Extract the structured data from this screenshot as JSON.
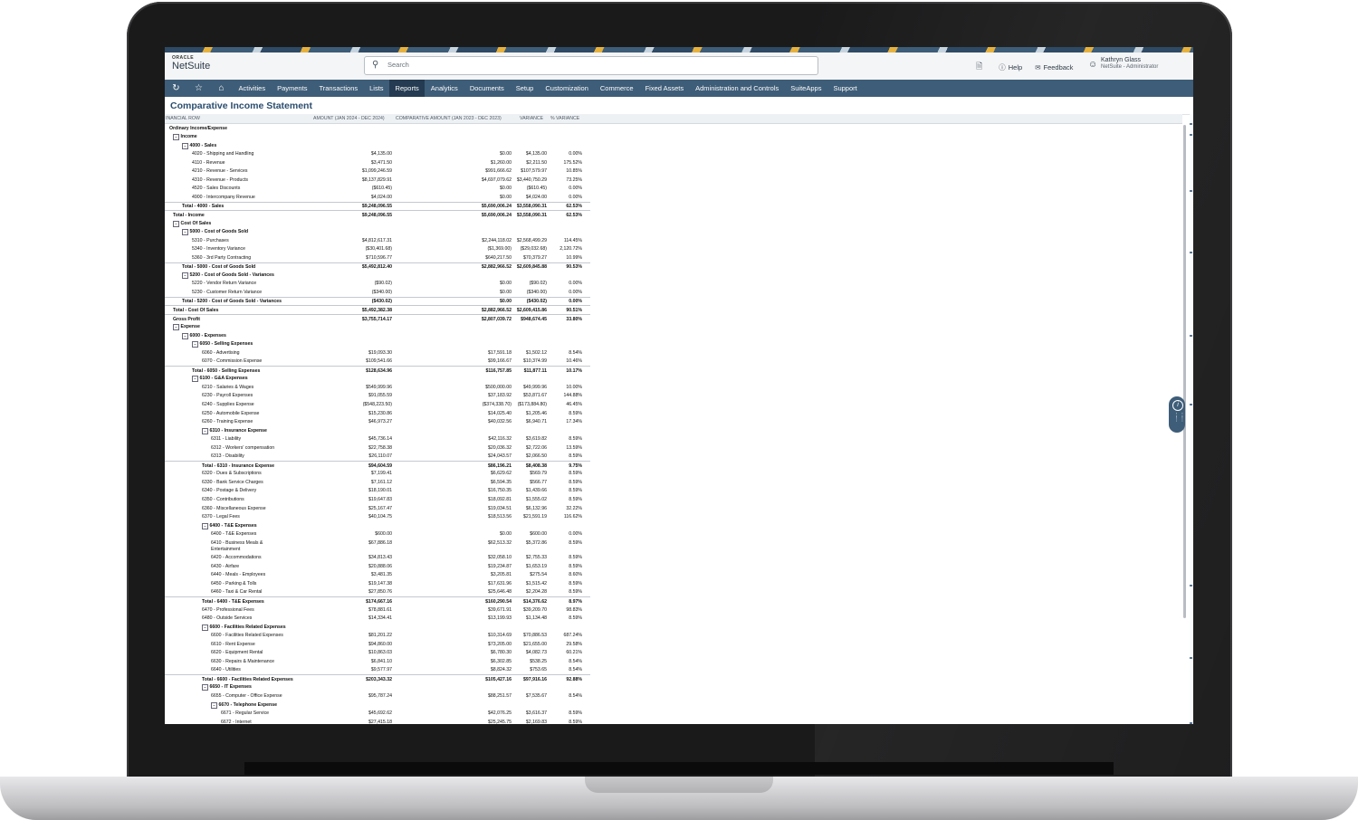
{
  "app": {
    "brand_small": "ORACLE",
    "brand": "NetSuite",
    "search_placeholder": "Search",
    "help": "Help",
    "feedback": "Feedback",
    "user_name": "Kathryn Glass",
    "user_role": "NetSuite - Administrator"
  },
  "nav": [
    "Activities",
    "Payments",
    "Transactions",
    "Lists",
    "Reports",
    "Analytics",
    "Documents",
    "Setup",
    "Customization",
    "Commerce",
    "Fixed Assets",
    "Administration and Controls",
    "SuiteApps",
    "Support"
  ],
  "nav_active": "Reports",
  "page_title": "Comparative Income Statement",
  "columns": {
    "row": "INANCIAL ROW",
    "amount": "AMOUNT (JAN 2024 - DEC 2024)",
    "comparative": "COMPARATIVE AMOUNT (JAN 2023 - DEC 2023)",
    "variance": "VARIANCE",
    "pct": "% VARIANCE"
  },
  "rows": [
    {
      "l": 0,
      "t": "Ordinary Income/Expense",
      "b": true,
      "tg": false
    },
    {
      "l": 1,
      "t": "Income",
      "b": true,
      "tg": true
    },
    {
      "l": 2,
      "t": "4000 - Sales",
      "b": true,
      "tg": true
    },
    {
      "l": 3,
      "t": "4020 - Shipping and Handling",
      "v": [
        "$4,135.00",
        "$0.00",
        "$4,135.00",
        "0.00%"
      ]
    },
    {
      "l": 3,
      "t": "4110 - Revenue",
      "v": [
        "$3,471.50",
        "$1,260.00",
        "$2,211.50",
        "175.52%"
      ]
    },
    {
      "l": 3,
      "t": "4210 - Revenue - Services",
      "v": [
        "$1,099,246.59",
        "$991,666.62",
        "$107,579.97",
        "10.85%"
      ]
    },
    {
      "l": 3,
      "t": "4310 - Revenue - Products",
      "v": [
        "$8,137,829.91",
        "$4,697,079.62",
        "$3,440,750.29",
        "73.25%"
      ]
    },
    {
      "l": 3,
      "t": "4520 - Sales Discounts",
      "v": [
        "($610.45)",
        "$0.00",
        "($610.45)",
        "0.00%"
      ]
    },
    {
      "l": 3,
      "t": "4900 - Intercompany Revenue",
      "v": [
        "$4,024.00",
        "$0.00",
        "$4,024.00",
        "0.00%"
      ]
    },
    {
      "l": 2,
      "t": "Total - 4000 - Sales",
      "b": true,
      "total": true,
      "v": [
        "$9,248,096.55",
        "$5,690,006.24",
        "$3,558,090.31",
        "62.53%"
      ]
    },
    {
      "l": 1,
      "t": "Total - Income",
      "b": true,
      "total": true,
      "v": [
        "$9,248,096.55",
        "$5,690,006.24",
        "$3,558,090.31",
        "62.53%"
      ]
    },
    {
      "l": 1,
      "t": "Cost Of Sales",
      "b": true,
      "tg": true
    },
    {
      "l": 2,
      "t": "5000 - Cost of Goods Sold",
      "b": true,
      "tg": true
    },
    {
      "l": 3,
      "t": "5310 - Purchases",
      "v": [
        "$4,812,617.31",
        "$2,244,118.02",
        "$2,568,499.29",
        "114.45%"
      ]
    },
    {
      "l": 3,
      "t": "5340 - Inventory Variance",
      "v": [
        "($30,401.68)",
        "($1,369.00)",
        "($29,032.68)",
        "2,120.72%"
      ]
    },
    {
      "l": 3,
      "t": "5360 - 3rd Party Contracting",
      "v": [
        "$710,596.77",
        "$640,217.50",
        "$70,379.27",
        "10.99%"
      ]
    },
    {
      "l": 2,
      "t": "Total - 5000 - Cost of Goods Sold",
      "b": true,
      "total": true,
      "v": [
        "$5,492,812.40",
        "$2,882,966.52",
        "$2,609,845.88",
        "90.53%"
      ]
    },
    {
      "l": 2,
      "t": "5200 - Cost of Goods Sold - Variances",
      "b": true,
      "tg": true
    },
    {
      "l": 3,
      "t": "5220 - Vendor Return Variance",
      "v": [
        "($90.02)",
        "$0.00",
        "($90.02)",
        "0.00%"
      ]
    },
    {
      "l": 3,
      "t": "5230 - Customer Return Variance",
      "v": [
        "($340.00)",
        "$0.00",
        "($340.00)",
        "0.00%"
      ]
    },
    {
      "l": 2,
      "t": "Total - 5200 - Cost of Goods Sold - Variances",
      "b": true,
      "total": true,
      "v": [
        "($430.02)",
        "$0.00",
        "($430.02)",
        "0.00%"
      ]
    },
    {
      "l": 1,
      "t": "Total - Cost Of Sales",
      "b": true,
      "total": true,
      "v": [
        "$5,492,382.38",
        "$2,882,966.52",
        "$2,609,415.86",
        "90.51%"
      ]
    },
    {
      "l": 1,
      "t": "Gross Profit",
      "b": true,
      "total": true,
      "v": [
        "$3,755,714.17",
        "$2,807,039.72",
        "$948,674.45",
        "33.80%"
      ]
    },
    {
      "l": 1,
      "t": "Expense",
      "b": true,
      "tg": true
    },
    {
      "l": 2,
      "t": "6000 - Expenses",
      "b": true,
      "tg": true
    },
    {
      "l": 3,
      "t": "6050 - Selling Expenses",
      "b": true,
      "tg": true
    },
    {
      "l": 4,
      "t": "6060 - Advertising",
      "v": [
        "$19,093.30",
        "$17,591.18",
        "$1,502.12",
        "8.54%"
      ]
    },
    {
      "l": 4,
      "t": "6070 - Commission Expense",
      "v": [
        "$109,541.66",
        "$99,166.67",
        "$10,374.99",
        "10.46%"
      ]
    },
    {
      "l": 3,
      "t": "Total - 6050 - Selling Expenses",
      "b": true,
      "total": true,
      "v": [
        "$128,634.96",
        "$116,757.85",
        "$11,877.11",
        "10.17%"
      ]
    },
    {
      "l": 3,
      "t": "6100 - G&A Expenses",
      "b": true,
      "tg": true
    },
    {
      "l": 4,
      "t": "6210 - Salaries & Wages",
      "v": [
        "$549,999.96",
        "$500,000.00",
        "$49,999.96",
        "10.00%"
      ]
    },
    {
      "l": 4,
      "t": "6230 - Payroll Expenses",
      "v": [
        "$91,055.59",
        "$37,183.92",
        "$53,871.67",
        "144.88%"
      ]
    },
    {
      "l": 4,
      "t": "6240 - Supplies Expense",
      "v": [
        "($548,223.50)",
        "($374,338.70)",
        "($173,884.80)",
        "46.45%"
      ]
    },
    {
      "l": 4,
      "t": "6250 - Automobile Expense",
      "v": [
        "$15,230.86",
        "$14,025.40",
        "$1,205.46",
        "8.59%"
      ]
    },
    {
      "l": 4,
      "t": "6260 - Training Expense",
      "v": [
        "$46,973.27",
        "$40,032.56",
        "$6,940.71",
        "17.34%"
      ]
    },
    {
      "l": 4,
      "t": "6310 - Insurance Expense",
      "b": true,
      "tg": true
    },
    {
      "l": 5,
      "t": "6311 - Liability",
      "v": [
        "$45,736.14",
        "$42,116.32",
        "$3,619.82",
        "8.59%"
      ]
    },
    {
      "l": 5,
      "t": "6312 - Workers' compensation",
      "v": [
        "$22,758.38",
        "$20,036.32",
        "$2,722.06",
        "13.59%"
      ]
    },
    {
      "l": 5,
      "t": "6313 - Disability",
      "v": [
        "$26,110.07",
        "$24,043.57",
        "$2,066.50",
        "8.59%"
      ]
    },
    {
      "l": 4,
      "t": "Total - 6310 - Insurance Expense",
      "b": true,
      "total": true,
      "v": [
        "$94,604.59",
        "$86,196.21",
        "$8,408.38",
        "9.75%"
      ]
    },
    {
      "l": 4,
      "t": "6320 - Dues & Subscriptions",
      "v": [
        "$7,199.41",
        "$6,629.62",
        "$569.79",
        "8.59%"
      ]
    },
    {
      "l": 4,
      "t": "6330 - Bank Service Charges",
      "v": [
        "$7,161.12",
        "$6,594.35",
        "$566.77",
        "8.59%"
      ]
    },
    {
      "l": 4,
      "t": "6340 - Postage & Delivery",
      "v": [
        "$18,190.01",
        "$16,750.35",
        "$1,439.66",
        "8.59%"
      ]
    },
    {
      "l": 4,
      "t": "6350 - Contributions",
      "v": [
        "$19,647.83",
        "$18,092.81",
        "$1,555.02",
        "8.59%"
      ]
    },
    {
      "l": 4,
      "t": "6360 - Miscellaneous Expense",
      "v": [
        "$25,167.47",
        "$19,034.51",
        "$6,132.96",
        "32.22%"
      ]
    },
    {
      "l": 4,
      "t": "6370 - Legal Fees",
      "v": [
        "$40,104.75",
        "$18,513.56",
        "$21,591.19",
        "116.62%"
      ]
    },
    {
      "l": 4,
      "t": "6400 - T&E Expenses",
      "b": true,
      "tg": true
    },
    {
      "l": 5,
      "t": "6400 - T&E Expenses",
      "v": [
        "$600.00",
        "$0.00",
        "$600.00",
        "0.00%"
      ]
    },
    {
      "l": 5,
      "t": "6410 - Business Meals & Entertainment",
      "tall": true,
      "v": [
        "$67,886.18",
        "$62,513.32",
        "$5,372.86",
        "8.59%"
      ]
    },
    {
      "l": 5,
      "t": "6420 - Accommodations",
      "v": [
        "$34,813.43",
        "$32,058.10",
        "$2,755.33",
        "8.59%"
      ]
    },
    {
      "l": 5,
      "t": "6430 - Airfare",
      "v": [
        "$20,888.06",
        "$19,234.87",
        "$1,653.19",
        "8.59%"
      ]
    },
    {
      "l": 5,
      "t": "6440 - Meals - Employees",
      "v": [
        "$3,481.35",
        "$3,205.81",
        "$275.54",
        "8.60%"
      ]
    },
    {
      "l": 5,
      "t": "6450 - Parking & Tolls",
      "v": [
        "$19,147.38",
        "$17,631.96",
        "$1,515.42",
        "8.59%"
      ]
    },
    {
      "l": 5,
      "t": "6460 - Taxi & Car Rental",
      "v": [
        "$27,850.76",
        "$25,646.48",
        "$2,204.28",
        "8.59%"
      ]
    },
    {
      "l": 4,
      "t": "Total - 6400 - T&E Expenses",
      "b": true,
      "total": true,
      "v": [
        "$174,667.16",
        "$160,290.54",
        "$14,376.62",
        "8.97%"
      ]
    },
    {
      "l": 4,
      "t": "6470 - Professional Fees",
      "v": [
        "$78,881.61",
        "$39,671.91",
        "$39,209.70",
        "98.83%"
      ]
    },
    {
      "l": 4,
      "t": "6480 - Outside Services",
      "v": [
        "$14,334.41",
        "$13,199.93",
        "$1,134.48",
        "8.59%"
      ]
    },
    {
      "l": 4,
      "t": "6600 - Facilities Related Expenses",
      "b": true,
      "tg": true
    },
    {
      "l": 5,
      "t": "6600 - Facilities Related Expenses",
      "v": [
        "$81,201.22",
        "$10,314.69",
        "$70,886.53",
        "687.24%"
      ]
    },
    {
      "l": 5,
      "t": "6610 - Rent Expense",
      "v": [
        "$94,860.00",
        "$73,205.00",
        "$21,655.00",
        "29.58%"
      ]
    },
    {
      "l": 5,
      "t": "6620 - Equipment Rental",
      "v": [
        "$10,863.03",
        "$6,780.30",
        "$4,082.73",
        "60.21%"
      ]
    },
    {
      "l": 5,
      "t": "6630 - Repairs & Maintenance",
      "v": [
        "$6,841.10",
        "$6,302.85",
        "$538.25",
        "8.54%"
      ]
    },
    {
      "l": 5,
      "t": "6640 - Utilities",
      "v": [
        "$9,577.97",
        "$8,824.32",
        "$753.65",
        "8.54%"
      ]
    },
    {
      "l": 4,
      "t": "Total - 6600 - Facilities Related Expenses",
      "b": true,
      "total": true,
      "v": [
        "$203,343.32",
        "$105,427.16",
        "$97,916.16",
        "92.88%"
      ]
    },
    {
      "l": 4,
      "t": "6650 - IT Expenses",
      "b": true,
      "tg": true
    },
    {
      "l": 5,
      "t": "6655 - Computer - Office Expense",
      "v": [
        "$95,787.24",
        "$88,251.57",
        "$7,535.67",
        "8.54%"
      ]
    },
    {
      "l": 5,
      "t": "6670 - Telephone Expense",
      "b": true,
      "tg": true
    },
    {
      "l": 6,
      "t": "6671 - Regular Service",
      "v": [
        "$45,692.62",
        "$42,076.25",
        "$3,616.37",
        "8.59%"
      ]
    },
    {
      "l": 6,
      "t": "6672 - Internet",
      "v": [
        "$27,415.18",
        "$25,245.75",
        "$2,169.83",
        "8.59%"
      ]
    }
  ]
}
